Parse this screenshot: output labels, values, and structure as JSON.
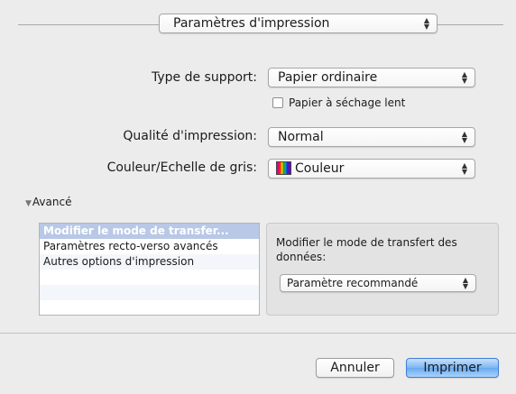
{
  "header": {
    "section_popup": "Paramètres d'impression"
  },
  "form": {
    "media_type": {
      "label": "Type de support:",
      "value": "Papier ordinaire"
    },
    "slow_dry": {
      "label": "Papier à séchage lent",
      "checked": false
    },
    "quality": {
      "label": "Qualité d'impression:",
      "value": "Normal"
    },
    "color": {
      "label": "Couleur/Echelle de gris:",
      "value": "Couleur",
      "icon": "color-swatch-icon"
    }
  },
  "advanced": {
    "toggle_label": "Avancé",
    "expanded": true,
    "items": [
      {
        "label": "Modifier le mode de transfer...",
        "selected": true
      },
      {
        "label": "Paramètres recto-verso avancés",
        "selected": false
      },
      {
        "label": "Autres options d'impression",
        "selected": false
      }
    ],
    "detail": {
      "label": "Modifier le mode de transfert des données:",
      "value": "Paramètre recommandé"
    }
  },
  "buttons": {
    "cancel": "Annuler",
    "print": "Imprimer"
  },
  "colors": {
    "window_bg": "#ececec",
    "selection": "#b9c8e6",
    "default_button": "#6aa9f0"
  }
}
